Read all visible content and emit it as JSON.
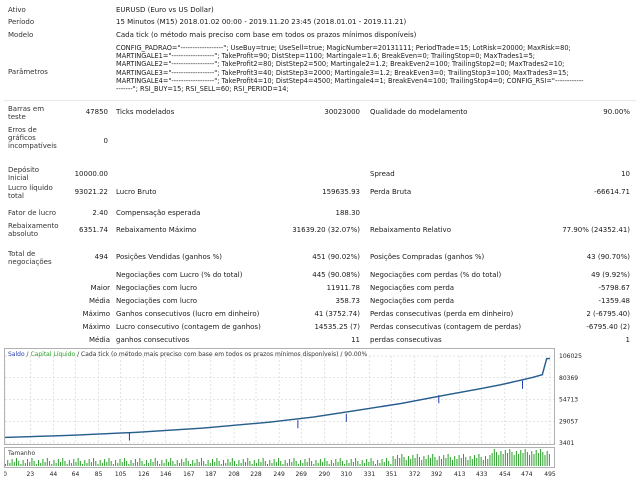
{
  "info": {
    "ativo_label": "Ativo",
    "ativo_value": "EURUSD (Euro vs US Dollar)",
    "periodo_label": "Período",
    "periodo_value": "15 Minutos (M15) 2018.01.02 00:00 - 2019.11.20 23:45 (2018.01.01 - 2019.11.21)",
    "modelo_label": "Modelo",
    "modelo_value": "Cada tick (o método mais preciso com base em todos os prazos mínimos disponíveis)",
    "parametros_label": "Parâmetros",
    "parametros_value": "CONFIG_PADRAO=\"------------------\"; UseBuy=true; UseSell=true; MagicNumber=20131111; PeriodTrade=15; LotRisk=20000; MaxRisk=80;\nMARTINGALE1=\"------------------\"; TakeProfit=90; DistStep=1100; Martingale=1.6; BreakEven=0; TrailingStop=0; MaxTrades1=5;\nMARTINGALE2=\"------------------\"; TakeProfit2=80; DistStep2=500; Martingale2=1.2; BreakEven2=100; TrailingStop2=0; MaxTrades2=10;\nMARTINGALE3=\"------------------\"; TakeProfit3=40; DistStep3=2000; Martingale3=1.2; BreakEven3=0; TrailingStop3=100; MaxTrades3=15;\nMARTINGALE4=\"------------------\"; TakeProfit4=10; DistStep4=4500; Martingale4=1; BreakEven4=100; TrailingStop4=0; CONFIG_RSI=\"------------\n-------\"; RSI_BUY=15; RSI_SELL=60; RSI_PERIOD=14;"
  },
  "stats": {
    "barras_label": "Barras em teste",
    "barras_value": "47850",
    "ticks_label": "Ticks modelados",
    "ticks_value": "30023000",
    "qualidade_label": "Qualidade do modelamento",
    "qualidade_value": "90.00%",
    "erros_label": "Erros de gráficos incompatíveis",
    "erros_value": "0",
    "deposito_label": "Depósito Inicial",
    "deposito_value": "10000.00",
    "spread_label": "Spread",
    "spread_value": "10",
    "lucro_liquido_label": "Lucro líquido total",
    "lucro_liquido_value": "93021.22",
    "lucro_bruto_label": "Lucro Bruto",
    "lucro_bruto_value": "159635.93",
    "perda_bruta_label": "Perda Bruta",
    "perda_bruta_value": "-66614.71",
    "fator_label": "Fator de lucro",
    "fator_value": "2.40",
    "compensacao_label": "Compensação esperada",
    "compensacao_value": "188.30",
    "rebaix_abs_label": "Rebaixamento absoluto",
    "rebaix_abs_value": "6351.74",
    "rebaix_max_label": "Rebaixamento Máximo",
    "rebaix_max_value": "31639.20 (32.07%)",
    "rebaix_rel_label": "Rebaixamento Relativo",
    "rebaix_rel_value": "77.90% (24352.41)",
    "total_neg_label": "Total de negociações",
    "total_neg_value": "494",
    "pos_vend_label": "Posições Vendidas (ganhos %)",
    "pos_vend_value": "451 (90.02%)",
    "pos_comp_label": "Posições Compradas (ganhos %)",
    "pos_comp_value": "43 (90.70%)",
    "neg_lucro_label": "Negociações com Lucro (% do total)",
    "neg_lucro_value": "445 (90.08%)",
    "neg_perda_label": "Negociações com perdas (% do total)",
    "neg_perda_value": "49 (9.92%)",
    "maior_label": "Maior",
    "maior_lucro_label": "Negociações com lucro",
    "maior_lucro_value": "11911.78",
    "maior_perda_label": "Negociações com perda",
    "maior_perda_value": "-5798.67",
    "media_label": "Média",
    "media_lucro_label": "Negociações com lucro",
    "media_lucro_value": "358.73",
    "media_perda_label": "Negociações com perda",
    "media_perda_value": "-1359.48",
    "maximo1_label": "Máximo",
    "ganhos_consec_din_label": "Ganhos consecutivos (lucro em dinheiro)",
    "ganhos_consec_din_value": "41 (3752.74)",
    "perdas_consec_din_label": "Perdas consecutivas (perda em dinheiro)",
    "perdas_consec_din_value": "2 (-6795.40)",
    "maximo2_label": "Máximo",
    "lucro_consec_cont_label": "Lucro consecutivo (contagem de ganhos)",
    "lucro_consec_cont_value": "14535.25 (7)",
    "perdas_consec_cont_label": "Perdas consecutivas (contagem de perdas)",
    "perdas_consec_cont_value": "-6795.40 (2)",
    "media2_label": "Média",
    "ganhos_consec_label": "ganhos consecutivos",
    "ganhos_consec_value": "11",
    "perdas_consec_label": "perdas consecutivas",
    "perdas_consec_value": "1"
  },
  "chart": {
    "legend_saldo": "Saldo",
    "legend_sep1": " / ",
    "legend_capital": "Capital Líquido",
    "legend_rest": " / Cada tick (o método mais preciso com base em todos os prazos mínimos disponíveis) / 90.00%",
    "volume_label": "Tamanho",
    "colors": {
      "balance": "#1f3fb0",
      "equity": "#2aa02a",
      "grid": "#c8c8c8",
      "legend_green": "#2aa02a"
    }
  },
  "chart_data": {
    "type": "line",
    "y_ticks": [
      "106025",
      "80369",
      "54713",
      "29057",
      "3401"
    ],
    "ylim": [
      3401,
      106025
    ],
    "x_ticks": [
      "0",
      "23",
      "44",
      "64",
      "85",
      "105",
      "126",
      "146",
      "167",
      "187",
      "208",
      "228",
      "249",
      "269",
      "290",
      "310",
      "331",
      "351",
      "372",
      "392",
      "413",
      "433",
      "454",
      "474",
      "495"
    ],
    "xlim": [
      0,
      495
    ],
    "series": [
      {
        "name": "Saldo",
        "x": [
          0,
          60,
          120,
          180,
          240,
          280,
          320,
          360,
          400,
          430,
          450,
          470,
          480,
          488,
          492,
          495
        ],
        "y": [
          10000,
          12500,
          16000,
          21000,
          28000,
          34000,
          42000,
          50000,
          60000,
          67000,
          72000,
          78000,
          81000,
          84000,
          103000,
          103000
        ]
      },
      {
        "name": "Capital Líquido",
        "x": [
          0,
          60,
          120,
          180,
          240,
          280,
          320,
          360,
          400,
          430,
          450,
          470,
          480,
          488,
          492,
          495
        ],
        "y": [
          10000,
          12500,
          16000,
          21000,
          28000,
          34000,
          42000,
          50000,
          60000,
          67000,
          72000,
          78000,
          81000,
          84000,
          103000,
          103000
        ]
      }
    ],
    "dips": [
      {
        "x": 113,
        "y": 11000
      },
      {
        "x": 266,
        "y": 25500
      },
      {
        "x": 310,
        "y": 33000
      },
      {
        "x": 394,
        "y": 55000
      },
      {
        "x": 470,
        "y": 72000
      }
    ]
  }
}
